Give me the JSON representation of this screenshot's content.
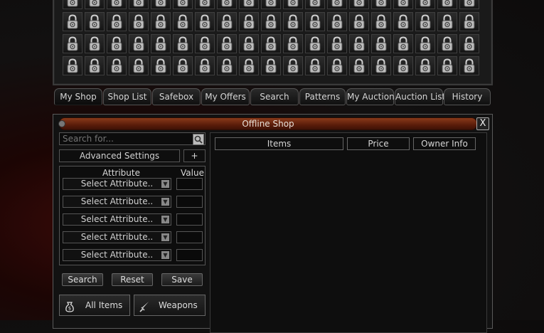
{
  "tabs": [
    "My Shop",
    "Shop List",
    "Safebox",
    "My Offers",
    "Search",
    "Patterns",
    "My Auction",
    "Auction List",
    "History"
  ],
  "active_tab": "My Shop",
  "locked_slot_icon": "padlock-icon",
  "window": {
    "title": "Offline Shop",
    "close_label": "X"
  },
  "search": {
    "placeholder": "Search for..."
  },
  "advanced_settings": {
    "label": "Advanced Settings",
    "add_label": "+"
  },
  "attributes": {
    "attribute_header": "Attribute",
    "value_header": "Value",
    "rows": [
      {
        "select": "Select Attribute.."
      },
      {
        "select": "Select Attribute.."
      },
      {
        "select": "Select Attribute.."
      },
      {
        "select": "Select Attribute.."
      },
      {
        "select": "Select Attribute.."
      }
    ]
  },
  "actions": {
    "search": "Search",
    "reset": "Reset",
    "save": "Save"
  },
  "categories": [
    {
      "label": "All Items",
      "icon": "money-bag-icon"
    },
    {
      "label": "Weapons",
      "icon": "sword-icon"
    }
  ],
  "columns": {
    "items": "Items",
    "price": "Price",
    "owner": "Owner Info"
  },
  "colors": {
    "title_bar": "#6a2410",
    "background_blood": "#3a0a08"
  }
}
